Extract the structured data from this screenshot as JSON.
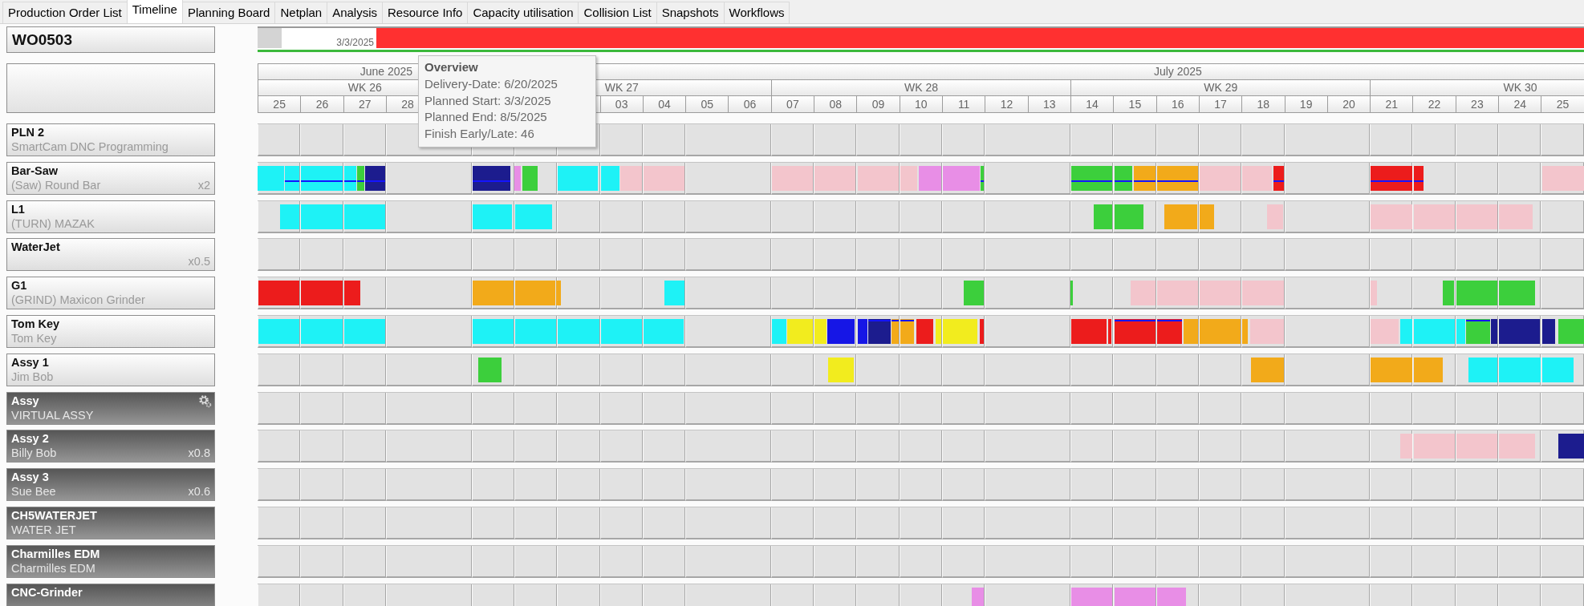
{
  "tabs": [
    {
      "label": "Production Order List",
      "selected": false
    },
    {
      "label": "Timeline",
      "selected": true
    },
    {
      "label": "Planning Board",
      "selected": false
    },
    {
      "label": "Netplan",
      "selected": false
    },
    {
      "label": "Analysis",
      "selected": false
    },
    {
      "label": "Resource Info",
      "selected": false
    },
    {
      "label": "Capacity utilisation",
      "selected": false
    },
    {
      "label": "Collision List",
      "selected": false
    },
    {
      "label": "Snapshots",
      "selected": false
    },
    {
      "label": "Workflows",
      "selected": false
    }
  ],
  "order": {
    "number": "WO0503",
    "start_date": "3/3/2025"
  },
  "tooltip": {
    "title": "Overview",
    "lines": [
      "Delivery-Date: 6/20/2025",
      "Planned Start: 3/3/2025",
      "Planned End: 8/5/2025",
      "Finish Early/Late: 46"
    ]
  },
  "months": [
    {
      "label": "June 2025"
    },
    {
      "label": "July 2025"
    }
  ],
  "weeks": [
    {
      "label": "WK 26",
      "days": [
        "25",
        "26",
        "27",
        "28"
      ]
    },
    {
      "label": "WK 27",
      "days": [
        "03",
        "04",
        "05",
        "06"
      ]
    },
    {
      "label": "WK 28",
      "days": [
        "07",
        "08",
        "09",
        "10",
        "11",
        "12",
        "13"
      ]
    },
    {
      "label": "WK 29",
      "days": [
        "14",
        "15",
        "16",
        "17",
        "18",
        "19",
        "20"
      ]
    },
    {
      "label": "WK 30",
      "days": [
        "21",
        "22",
        "23",
        "24",
        "25"
      ]
    }
  ],
  "resources": [
    {
      "name": "PLN 2",
      "detail": "SmartCam DNC Programming",
      "kind": "standard",
      "gear": false
    },
    {
      "name": "Bar-Saw",
      "detail": "(Saw) Round Bar",
      "factor": "x2",
      "kind": "standard",
      "gear": false,
      "bars": [
        {
          "color": "#1ef2f6",
          "linked": false
        },
        {
          "color": "#1ef2f6",
          "linked": true,
          "link_at_top": false
        },
        {
          "color": "#1ef2f6",
          "linked": true,
          "link_at_top": false
        },
        {
          "color": "#1ef2f6",
          "linked": true,
          "link_at_top": false
        },
        {
          "color": "#3ccf3c",
          "linked": true,
          "link_at_top": false
        },
        {
          "color": "#1c1c8e",
          "linked": true,
          "link_at_top": false
        },
        {
          "color": "#1c1c8e",
          "linked": true,
          "link_at_top": false
        },
        {
          "color": "#e88ee6",
          "linked": false
        },
        {
          "color": "#3ccf3c",
          "linked": false
        },
        {
          "color": "#1ef2f6",
          "linked": false
        },
        {
          "color": "#1ef2f6",
          "linked": false
        },
        {
          "color": "#f3c5cc",
          "linked": false
        },
        {
          "color": "#f3c5cc",
          "linked": false
        },
        {
          "color": "#f3c5cc",
          "linked": false
        },
        {
          "color": "#f3c5cc",
          "linked": false
        },
        {
          "color": "#f3c5cc",
          "linked": false
        },
        {
          "color": "#f3c5cc",
          "linked": false
        },
        {
          "color": "#e88ee6",
          "linked": false
        },
        {
          "color": "#e88ee6",
          "linked": false
        },
        {
          "color": "#3ccf3c",
          "linked": true,
          "link_at_top": false
        },
        {
          "color": "#3ccf3c",
          "linked": true,
          "link_at_top": false
        },
        {
          "color": "#3ccf3c",
          "linked": true,
          "link_at_top": false
        },
        {
          "color": "#f2aa1a",
          "linked": true,
          "link_at_top": false
        },
        {
          "color": "#f2aa1a",
          "linked": true,
          "link_at_top": false
        },
        {
          "color": "#f3c5cc",
          "linked": false
        },
        {
          "color": "#f3c5cc",
          "linked": false
        },
        {
          "color": "#ec1c1c",
          "linked": true,
          "link_at_top": false
        },
        {
          "color": "#ec1c1c",
          "linked": true,
          "link_at_top": false
        },
        {
          "color": "#ec1c1c",
          "linked": true,
          "link_at_top": false
        },
        {
          "color": "#f3c5cc",
          "linked": false
        }
      ]
    },
    {
      "name": "L1",
      "detail": "(TURN) MAZAK",
      "kind": "standard",
      "gear": false,
      "bars": [
        {
          "color": "#1ef2f6",
          "linked": false
        },
        {
          "color": "#1ef2f6",
          "linked": false
        },
        {
          "color": "#1ef2f6",
          "linked": false
        },
        {
          "color": "#1ef2f6",
          "linked": false
        },
        {
          "color": "#1ef2f6",
          "linked": false
        },
        {
          "color": "#3ccf3c",
          "linked": false
        },
        {
          "color": "#3ccf3c",
          "linked": false
        },
        {
          "color": "#f2aa1a",
          "linked": false
        },
        {
          "color": "#f2aa1a",
          "linked": false
        },
        {
          "color": "#f3c5cc",
          "linked": false
        },
        {
          "color": "#f3c5cc",
          "linked": false
        },
        {
          "color": "#f3c5cc",
          "linked": false
        },
        {
          "color": "#f3c5cc",
          "linked": false
        },
        {
          "color": "#f3c5cc",
          "linked": false
        }
      ]
    },
    {
      "name": "WaterJet",
      "factor": "x0.5",
      "kind": "standard",
      "gear": false
    },
    {
      "name": "G1",
      "detail": "(GRIND) Maxicon Grinder",
      "kind": "standard",
      "gear": false,
      "bars": [
        {
          "color": "#ec1c1c",
          "linked": false
        },
        {
          "color": "#ec1c1c",
          "linked": false
        },
        {
          "color": "#ec1c1c",
          "linked": false
        },
        {
          "color": "#f2aa1a",
          "linked": false
        },
        {
          "color": "#f2aa1a",
          "linked": false
        },
        {
          "color": "#f2aa1a",
          "linked": false
        },
        {
          "color": "#1ef2f6",
          "linked": false
        },
        {
          "color": "#3ccf3c",
          "linked": false
        },
        {
          "color": "#3ccf3c",
          "linked": false
        },
        {
          "color": "#f3c5cc",
          "linked": false
        },
        {
          "color": "#f3c5cc",
          "linked": false
        },
        {
          "color": "#f3c5cc",
          "linked": false
        },
        {
          "color": "#f3c5cc",
          "linked": false
        },
        {
          "color": "#f3c5cc",
          "linked": false
        },
        {
          "color": "#3ccf3c",
          "linked": false
        },
        {
          "color": "#3ccf3c",
          "linked": false
        },
        {
          "color": "#3ccf3c",
          "linked": false
        }
      ]
    },
    {
      "name": "Tom Key",
      "detail": "Tom Key",
      "kind": "standard",
      "gear": false,
      "bars": [
        {
          "color": "#1ef2f6",
          "linked": false
        },
        {
          "color": "#1ef2f6",
          "linked": false
        },
        {
          "color": "#1ef2f6",
          "linked": false
        },
        {
          "color": "#1ef2f6",
          "linked": false
        },
        {
          "color": "#1ef2f6",
          "linked": false
        },
        {
          "color": "#1ef2f6",
          "linked": false
        },
        {
          "color": "#1ef2f6",
          "linked": false
        },
        {
          "color": "#1ef2f6",
          "linked": false
        },
        {
          "color": "#1ef2f6",
          "linked": false
        },
        {
          "color": "#f2ec1e",
          "linked": false
        },
        {
          "color": "#f2ec1e",
          "linked": false
        },
        {
          "color": "#1616e6",
          "linked": false
        },
        {
          "color": "#1616e6",
          "linked": false
        },
        {
          "color": "#1c1c8e",
          "linked": true,
          "link_at_top": true
        },
        {
          "color": "#f2aa1a",
          "linked": true,
          "link_at_top": true
        },
        {
          "color": "#f2aa1a",
          "linked": true,
          "link_at_top": true
        },
        {
          "color": "#ec1c1c",
          "linked": false
        },
        {
          "color": "#f2ec1e",
          "linked": false
        },
        {
          "color": "#f2ec1e",
          "linked": false
        },
        {
          "color": "#ec1c1c",
          "linked": false
        },
        {
          "color": "#ec1c1c",
          "linked": false
        },
        {
          "color": "#ec1c1c",
          "linked": false
        },
        {
          "color": "#ec1c1c",
          "linked": true,
          "link_at_top": true
        },
        {
          "color": "#ec1c1c",
          "linked": true,
          "link_at_top": true
        },
        {
          "color": "#f2aa1a",
          "linked": false
        },
        {
          "color": "#f2aa1a",
          "linked": false
        },
        {
          "color": "#f2aa1a",
          "linked": false
        },
        {
          "color": "#f3c5cc",
          "linked": false
        },
        {
          "color": "#f3c5cc",
          "linked": false
        },
        {
          "color": "#1ef2f6",
          "linked": false
        },
        {
          "color": "#1ef2f6",
          "linked": false
        },
        {
          "color": "#1ef2f6",
          "linked": false
        },
        {
          "color": "#3ccf3c",
          "linked": true,
          "link_at_top": true
        },
        {
          "color": "#1c1c8e",
          "linked": false
        },
        {
          "color": "#1c1c8e",
          "linked": false
        },
        {
          "color": "#1c1c8e",
          "linked": false
        },
        {
          "color": "#3ccf3c",
          "linked": false
        }
      ]
    },
    {
      "name": "Assy 1",
      "detail": "Jim Bob",
      "kind": "standard",
      "gear": false,
      "bars": [
        {
          "color": "#3ccf3c",
          "linked": false
        },
        {
          "color": "#f2ec1e",
          "linked": false
        },
        {
          "color": "#f2aa1a",
          "linked": false
        },
        {
          "color": "#f2aa1a",
          "linked": false
        },
        {
          "color": "#f2aa1a",
          "linked": false
        },
        {
          "color": "#1ef2f6",
          "linked": false
        },
        {
          "color": "#1ef2f6",
          "linked": false
        },
        {
          "color": "#1ef2f6",
          "linked": false
        }
      ]
    },
    {
      "name": "Assy",
      "detail": "VIRTUAL ASSY",
      "kind": "shaded",
      "gear": true
    },
    {
      "name": "Assy 2",
      "detail": "Billy Bob",
      "factor": "x0.8",
      "kind": "shaded",
      "gear": false,
      "bars": [
        {
          "color": "#f3c5cc",
          "linked": false
        },
        {
          "color": "#f3c5cc",
          "linked": false
        },
        {
          "color": "#f3c5cc",
          "linked": false
        },
        {
          "color": "#f3c5cc",
          "linked": false
        },
        {
          "color": "#1c1c8e",
          "linked": false
        }
      ]
    },
    {
      "name": "Assy 3",
      "detail": "Sue Bee",
      "factor": "x0.6",
      "kind": "shaded",
      "gear": false
    },
    {
      "name": "CH5WATERJET",
      "detail": "WATER JET",
      "kind": "shaded",
      "gear": false
    },
    {
      "name": "Charmilles EDM",
      "detail": "Charmilles EDM",
      "kind": "shaded",
      "gear": false
    },
    {
      "name": "CNC-Grinder",
      "kind": "shaded",
      "gear": false,
      "bars": [
        {
          "color": "#e88ee6",
          "linked": false
        },
        {
          "color": "#e88ee6",
          "linked": false
        },
        {
          "color": "#e88ee6",
          "linked": false
        },
        {
          "color": "#e88ee6",
          "linked": false
        }
      ]
    }
  ]
}
